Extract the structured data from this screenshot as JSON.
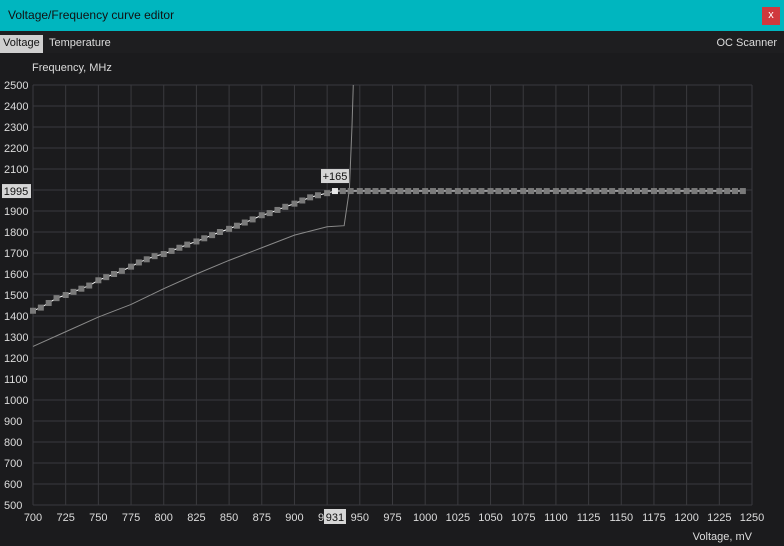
{
  "window": {
    "title": "Voltage/Frequency curve editor",
    "close_label": "x"
  },
  "tabs": {
    "voltage": "Voltage",
    "temperature": "Temperature",
    "oc_scanner": "OC Scanner"
  },
  "colors": {
    "titlebar": "#00b6bf",
    "close": "#d0393e",
    "grid": "#3a3a3e",
    "curve": "#ffffff",
    "points": "#7a7a7a"
  },
  "chart_data": {
    "type": "line",
    "ylabel": "Frequency, MHz",
    "xlabel": "Voltage, mV",
    "xlim": [
      700,
      1250
    ],
    "ylim": [
      500,
      2500
    ],
    "x_ticks": [
      700,
      725,
      750,
      775,
      800,
      825,
      850,
      875,
      900,
      925,
      950,
      975,
      1000,
      1025,
      1050,
      1075,
      1100,
      1125,
      1150,
      1175,
      1200,
      1225,
      1250
    ],
    "y_ticks": [
      500,
      600,
      700,
      800,
      900,
      1000,
      1100,
      1200,
      1300,
      1400,
      1500,
      1600,
      1700,
      1800,
      1900,
      2000,
      2100,
      2200,
      2300,
      2400,
      2500
    ],
    "grid": true,
    "selected_point": {
      "voltage": 931,
      "frequency": 1995,
      "offset_label": "+165"
    },
    "series": [
      {
        "role": "edited curve points",
        "x": [
          700,
          706,
          712,
          718,
          725,
          731,
          737,
          743,
          750,
          756,
          762,
          768,
          775,
          781,
          787,
          793,
          800,
          806,
          812,
          818,
          825,
          831,
          837,
          843,
          850,
          856,
          862,
          868,
          875,
          881,
          887,
          893,
          900,
          906,
          912,
          918,
          925,
          931,
          937,
          943,
          950,
          956,
          962,
          968,
          975,
          981,
          987,
          993,
          1000,
          1006,
          1012,
          1018,
          1025,
          1031,
          1037,
          1043,
          1050,
          1056,
          1062,
          1068,
          1075,
          1081,
          1087,
          1093,
          1100,
          1106,
          1112,
          1118,
          1125,
          1131,
          1137,
          1143,
          1150,
          1156,
          1162,
          1168,
          1175,
          1181,
          1187,
          1193,
          1200,
          1206,
          1212,
          1218,
          1225,
          1231,
          1237,
          1243
        ],
        "y": [
          1425,
          1440,
          1462,
          1485,
          1500,
          1515,
          1530,
          1545,
          1570,
          1585,
          1600,
          1615,
          1635,
          1655,
          1670,
          1685,
          1695,
          1710,
          1725,
          1740,
          1755,
          1770,
          1785,
          1800,
          1815,
          1830,
          1845,
          1860,
          1880,
          1890,
          1905,
          1920,
          1935,
          1950,
          1965,
          1975,
          1985,
          1995,
          1995,
          1995,
          1995,
          1995,
          1995,
          1995,
          1995,
          1995,
          1995,
          1995,
          1995,
          1995,
          1995,
          1995,
          1995,
          1995,
          1995,
          1995,
          1995,
          1995,
          1995,
          1995,
          1995,
          1995,
          1995,
          1995,
          1995,
          1995,
          1995,
          1995,
          1995,
          1995,
          1995,
          1995,
          1995,
          1995,
          1995,
          1995,
          1995,
          1995,
          1995,
          1995,
          1995,
          1995,
          1995,
          1995,
          1995,
          1995,
          1995,
          1995
        ]
      },
      {
        "role": "default curve",
        "x": [
          700,
          725,
          750,
          775,
          800,
          825,
          850,
          875,
          900,
          925,
          938,
          942,
          944,
          945
        ],
        "y": [
          1255,
          1325,
          1395,
          1455,
          1530,
          1600,
          1665,
          1725,
          1785,
          1825,
          1830,
          2000,
          2300,
          2500
        ]
      }
    ]
  }
}
